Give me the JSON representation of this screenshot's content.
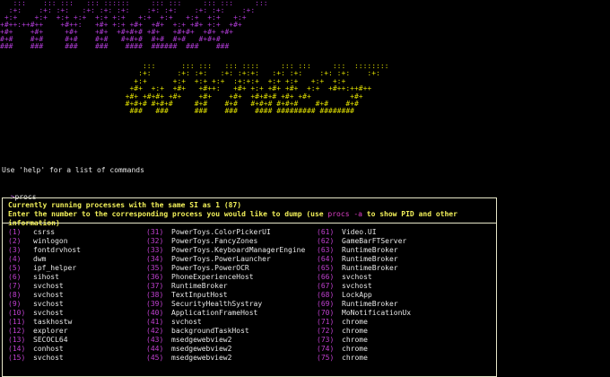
{
  "banner": {
    "purple": "   :::    ::: :::   ::: ::::::     ::: :::     ::: :::     :::\n  :+:    :+: :+:   :+: :+: :+:    :+: :+:    :+: :+:    :+:\n +:+    +:+  +:+ +:+  +:+ +:+   +:+  +:+   +:+  +:+   +:+\n+#++:++#++    +#++:   +#+ +:+ +#+  +#+  +:+ +#+ +:+  +#+\n+#+    +#+     +#+    +#+  +#+#+# +#+   +#+#+  +#+ +#+\n#+#    #+#     #+#    #+#   #+#+#  #+#  #+#   #+#+#\n###    ###     ###    ###    ####  ######  ###    ###",
    "yellow": "                                 :::      ::: :::   ::: ::::     ::: :::     :::  ::::::::\n                                :+:      :+: :+:   :+: :+:+:   :+: :+:    :+: :+:    :+:\n                               +:+      +:+  +:+ +:+  :+:+:+  +:+ +:+   +:+  +:+\n                              +#+  +:+  +#+   +#++:   +#+ +:+ +#+ +#+  +:+  +#++:++#++\n                             +#+ +#+#+ +#+    +#+    +#+  +#+#+# +#+ +#+         +#+\n                             #+#+# #+#+#     #+#    #+#   #+#+# #+#+#    #+#    #+#\n                              ###   ###      ###    ###    #### ######### ########"
  },
  "terminal": {
    "help_line": "Use 'help' for a list of commands",
    "prompt_symbol": ">",
    "command": "procs"
  },
  "panel": {
    "title": "Currently running processes with the same SI as 1 (87)",
    "instruction_pre": "Enter the number to the corresponding process you would like to dump (use ",
    "instruction_cmd": "procs -a",
    "instruction_post": " to show PID and other information)"
  },
  "processes": {
    "col1": [
      {
        "n": "(1)",
        "name": "csrss"
      },
      {
        "n": "(2)",
        "name": "winlogon"
      },
      {
        "n": "(3)",
        "name": "fontdrvhost"
      },
      {
        "n": "(4)",
        "name": "dwm"
      },
      {
        "n": "(5)",
        "name": "ipf_helper"
      },
      {
        "n": "(6)",
        "name": "sihost"
      },
      {
        "n": "(7)",
        "name": "svchost"
      },
      {
        "n": "(8)",
        "name": "svchost"
      },
      {
        "n": "(9)",
        "name": "svchost"
      },
      {
        "n": "(10)",
        "name": "svchost"
      },
      {
        "n": "(11)",
        "name": "taskhostw"
      },
      {
        "n": "(12)",
        "name": "explorer"
      },
      {
        "n": "(13)",
        "name": "SECOCL64"
      },
      {
        "n": "(14)",
        "name": "conhost"
      },
      {
        "n": "(15)",
        "name": "svchost"
      }
    ],
    "col2": [
      {
        "n": "(31)",
        "name": "PowerToys.ColorPickerUI"
      },
      {
        "n": "(32)",
        "name": "PowerToys.FancyZones"
      },
      {
        "n": "(33)",
        "name": "PowerToys.KeyboardManagerEngine"
      },
      {
        "n": "(34)",
        "name": "PowerToys.PowerLauncher"
      },
      {
        "n": "(35)",
        "name": "PowerToys.PowerOCR"
      },
      {
        "n": "(36)",
        "name": "PhoneExperienceHost"
      },
      {
        "n": "(37)",
        "name": "RuntimeBroker"
      },
      {
        "n": "(38)",
        "name": "TextInputHost"
      },
      {
        "n": "(39)",
        "name": "SecurityHealthSystray"
      },
      {
        "n": "(40)",
        "name": "ApplicationFrameHost"
      },
      {
        "n": "(41)",
        "name": "svchost"
      },
      {
        "n": "(42)",
        "name": "backgroundTaskHost"
      },
      {
        "n": "(43)",
        "name": "msedgewebview2"
      },
      {
        "n": "(44)",
        "name": "msedgewebview2"
      },
      {
        "n": "(45)",
        "name": "msedgewebview2"
      }
    ],
    "col3": [
      {
        "n": "(61)",
        "name": "Video.UI"
      },
      {
        "n": "(62)",
        "name": "GameBarFTServer"
      },
      {
        "n": "(63)",
        "name": "RuntimeBroker"
      },
      {
        "n": "(64)",
        "name": "RuntimeBroker"
      },
      {
        "n": "(65)",
        "name": "RuntimeBroker"
      },
      {
        "n": "(66)",
        "name": "svchost"
      },
      {
        "n": "(67)",
        "name": "svchost"
      },
      {
        "n": "(68)",
        "name": "LockApp"
      },
      {
        "n": "(69)",
        "name": "RuntimeBroker"
      },
      {
        "n": "(70)",
        "name": "MoNotificationUx"
      },
      {
        "n": "(71)",
        "name": "chrome"
      },
      {
        "n": "(72)",
        "name": "chrome"
      },
      {
        "n": "(73)",
        "name": "chrome"
      },
      {
        "n": "(74)",
        "name": "chrome"
      },
      {
        "n": "(75)",
        "name": "chrome"
      }
    ]
  },
  "colors": {
    "banner_purple": "#b03cd6",
    "banner_yellow": "#e0df00",
    "index": "#c040d0",
    "panel_text": "#f2f05a"
  }
}
